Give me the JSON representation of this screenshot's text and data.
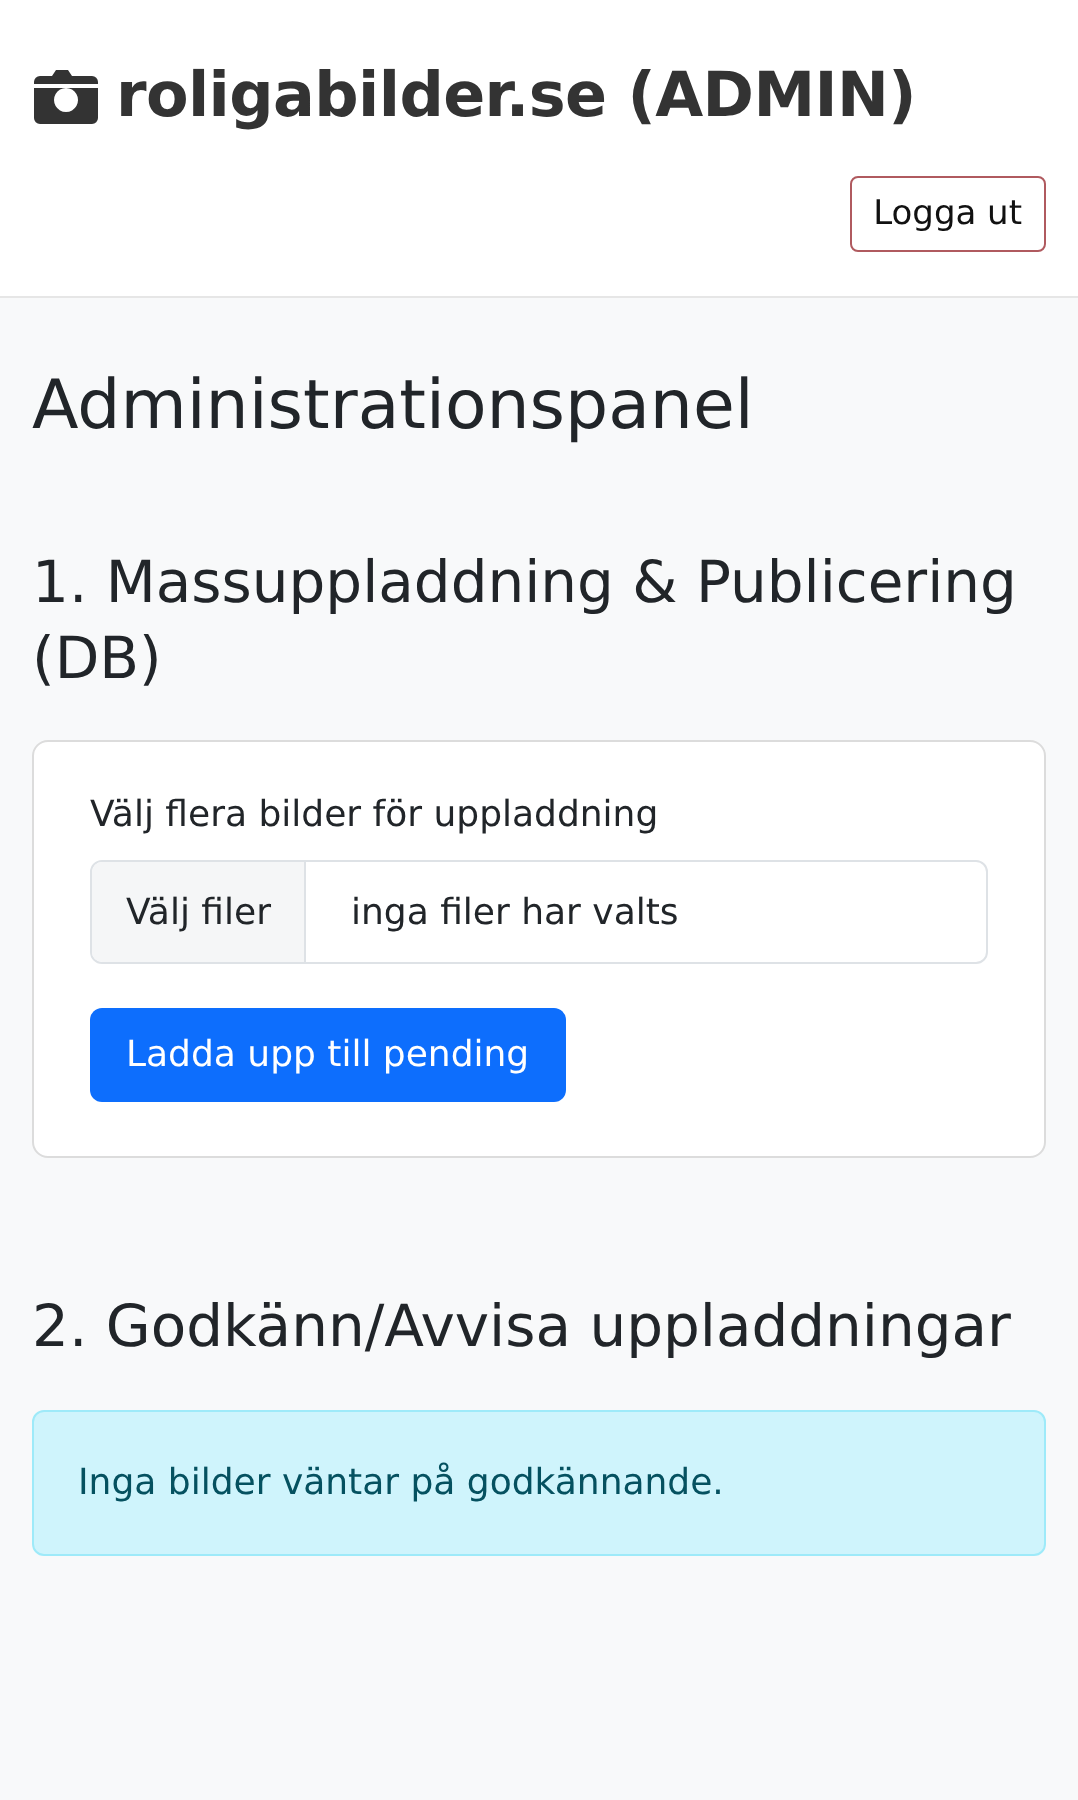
{
  "header": {
    "title": "roligabilder.se (ADMIN)",
    "logout_button": "Logga ut"
  },
  "page_title": "Administrationspanel",
  "sections": [
    {
      "kind": "upload",
      "heading": "1. Massuppladdning & Publicering (DB)",
      "field_label": "Välj flera bilder för uppladdning",
      "file_button": "Välj filer",
      "file_status": "inga filer har valts",
      "submit_button": "Ladda upp till pending"
    },
    {
      "kind": "alert",
      "heading": "2. Godkänn/Avvisa uppladdningar",
      "message": "Inga bilder väntar på godkännande."
    }
  ]
}
